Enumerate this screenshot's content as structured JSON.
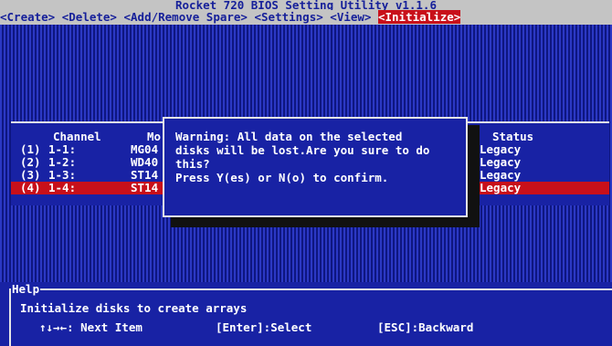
{
  "title": "Rocket 720 BIOS Setting Utility v1.1.6",
  "menu": [
    {
      "label": "<Create>",
      "active": false
    },
    {
      "label": "<Delete>",
      "active": false
    },
    {
      "label": "<Add/Remove Spare>",
      "active": false
    },
    {
      "label": "<Settings>",
      "active": false
    },
    {
      "label": "<View>",
      "active": false
    },
    {
      "label": "<Initialize>",
      "active": true
    }
  ],
  "table": {
    "headers": {
      "channel": "Channel",
      "model": "Mo",
      "status": "Status"
    },
    "rows": [
      {
        "idx": "(1)",
        "channel": "1-1:",
        "model": "MG04",
        "status": "Legacy",
        "selected": false
      },
      {
        "idx": "(2)",
        "channel": "1-2:",
        "model": "WD40",
        "status": "Legacy",
        "selected": false
      },
      {
        "idx": "(3)",
        "channel": "1-3:",
        "model": "ST14",
        "status": "Legacy",
        "selected": false
      },
      {
        "idx": "(4)",
        "channel": "1-4:",
        "model": "ST14",
        "status": "Legacy",
        "selected": true
      }
    ]
  },
  "dialog": {
    "lines": [
      "Warning: All data on the selected",
      "disks will be lost.Are you sure to do",
      "this?",
      "Press Y(es) or N(o) to confirm."
    ]
  },
  "help": {
    "title": "Help",
    "text": "Initialize disks to create arrays",
    "keys": {
      "next": "↑↓→←: Next Item",
      "select": "[Enter]:Select",
      "back": "[ESC]:Backward"
    }
  },
  "colors": {
    "background": "#1e2aa0",
    "menu_bg": "#c4c4c4",
    "menu_fg": "#16209a",
    "highlight": "#c8101a",
    "text": "#ffffff"
  }
}
